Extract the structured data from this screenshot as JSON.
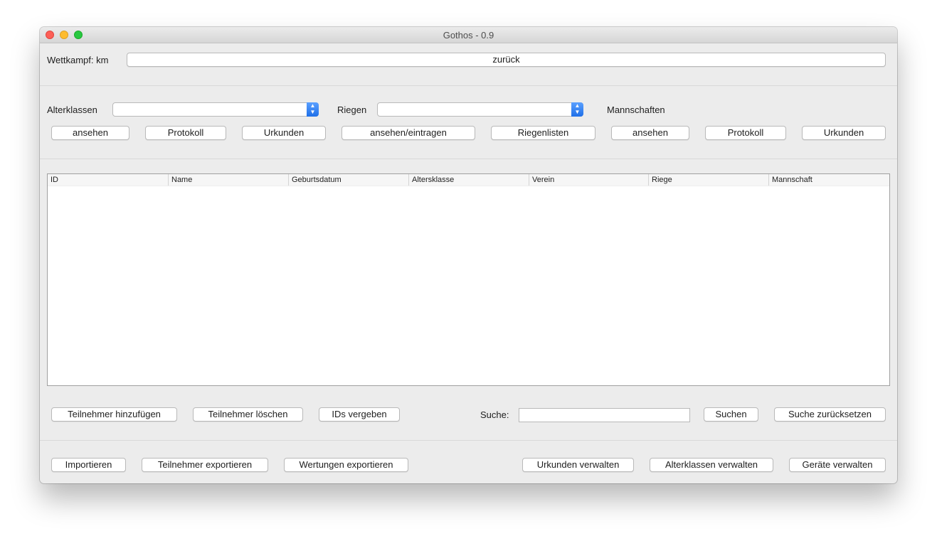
{
  "window": {
    "title": "Gothos - 0.9"
  },
  "top": {
    "wettkampf_label": "Wettkampf: km",
    "back_label": "zurück"
  },
  "groups": {
    "alterklassen_label": "Alterklassen",
    "riegen_label": "Riegen",
    "mannschaften_label": "Mannschaften",
    "alterklassen_selected": "",
    "riegen_selected": ""
  },
  "group_buttons": {
    "ak_ansehen": "ansehen",
    "ak_protokoll": "Protokoll",
    "ak_urkunden": "Urkunden",
    "riegen_ansehen_eintragen": "ansehen/eintragen",
    "riegen_listen": "Riegenlisten",
    "ms_ansehen": "ansehen",
    "ms_protokoll": "Protokoll",
    "ms_urkunden": "Urkunden"
  },
  "table": {
    "columns": [
      "ID",
      "Name",
      "Geburtsdatum",
      "Altersklasse",
      "Verein",
      "Riege",
      "Mannschaft"
    ],
    "rows": []
  },
  "actions": {
    "add": "Teilnehmer hinzufügen",
    "delete": "Teilnehmer löschen",
    "assign_ids": "IDs vergeben",
    "search_label": "Suche:",
    "search_value": "",
    "search_button": "Suchen",
    "reset_search": "Suche zurücksetzen"
  },
  "bottom": {
    "import": "Importieren",
    "export_participants": "Teilnehmer exportieren",
    "export_scores": "Wertungen exportieren",
    "manage_certificates": "Urkunden verwalten",
    "manage_ageclasses": "Alterklassen verwalten",
    "manage_devices": "Geräte verwalten"
  }
}
